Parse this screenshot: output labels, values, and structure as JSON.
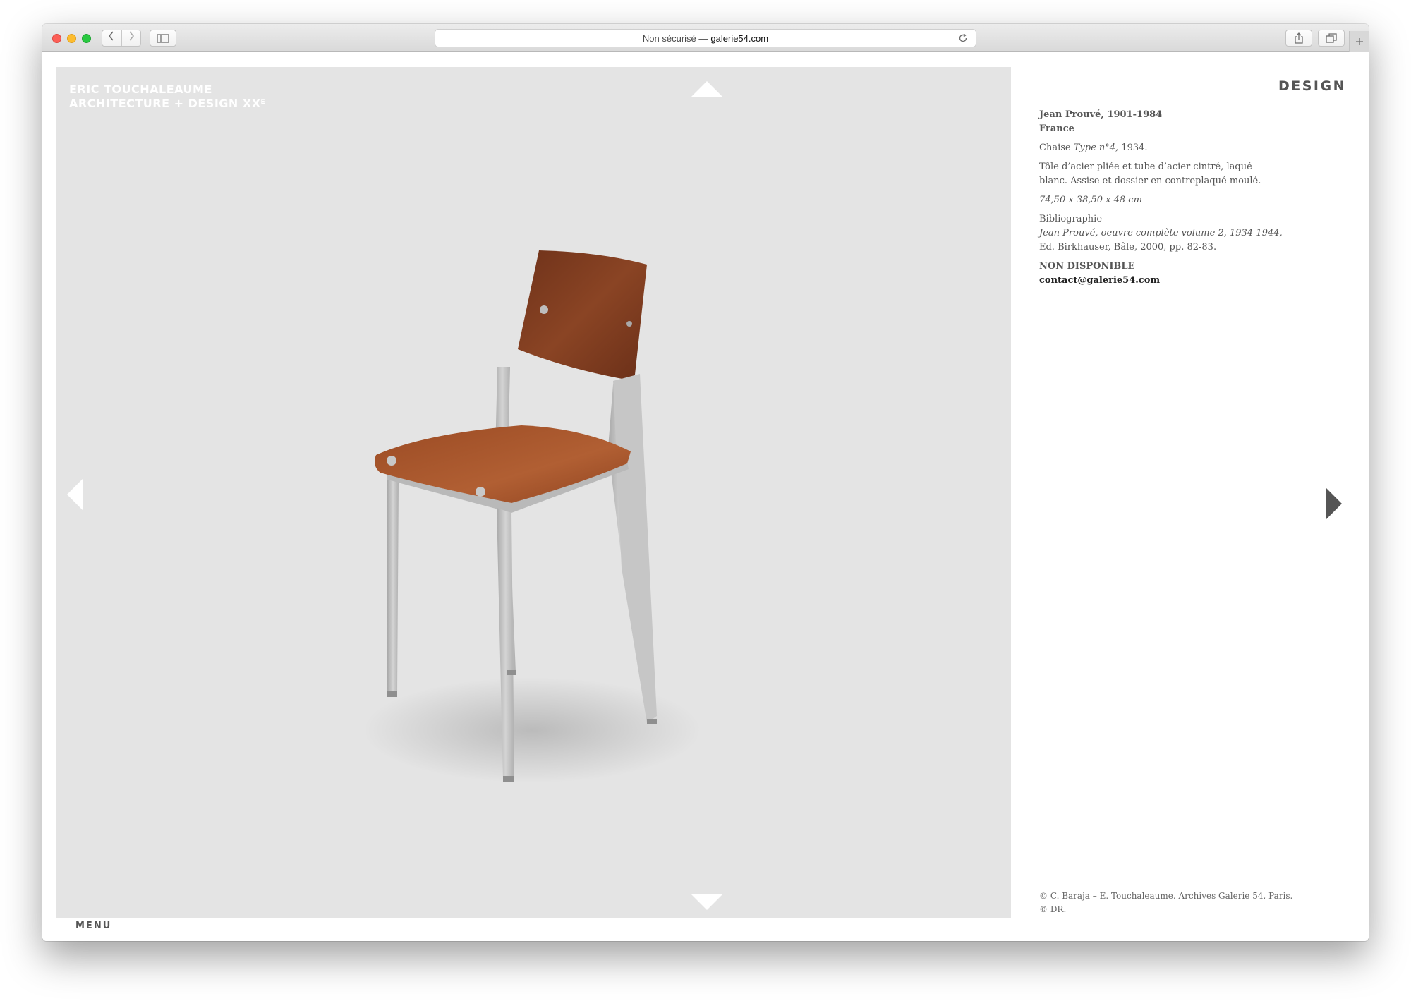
{
  "browser": {
    "address_prefix": "Non sécurisé —",
    "address_host": "galerie54.com"
  },
  "site": {
    "logo_line1": "Eric Touchaleaume",
    "logo_line2": "Architecture + Design XX",
    "logo_sup": "e",
    "section": "DESIGN",
    "menu": "MENU"
  },
  "artwork": {
    "designer": "Jean Prouvé, 1901-1984",
    "country": "France",
    "title_prefix": "Chaise",
    "title_italic": "Type n°4,",
    "title_year": "1934.",
    "materials_line1": "Tôle d’acier pliée et tube d’acier cintré, laqué",
    "materials_line2": "blanc. Assise et dossier en contreplaqué moulé.",
    "dimensions": "74,50 x 38,50 x 48 cm",
    "biblio_label": "Bibliographie",
    "biblio_line1": "Jean Prouvé, oeuvre complète volume 2, 1934-1944,",
    "biblio_line2": "Ed. Birkhauser, Bâle, 2000, pp. 82-83.",
    "availability": "NON DISPONIBLE",
    "contact": "contact@galerie54.com"
  },
  "credits": {
    "line1": "© C. Baraja – E. Touchaleaume. Archives Galerie 54, Paris.",
    "line2": "© DR."
  },
  "colors": {
    "image_bg": "#e4e4e4",
    "text": "#555555",
    "seat_wood": "#a8532a",
    "back_wood": "#7a3a1f",
    "steel": "#c3c3c3"
  }
}
